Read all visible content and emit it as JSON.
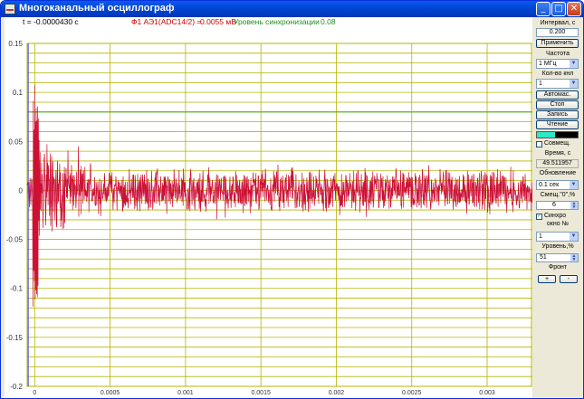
{
  "window": {
    "title": "Многоканальный осциллограф",
    "buttons": {
      "minimize": "_",
      "maximize": "□",
      "close": "✕"
    }
  },
  "plot_header": {
    "time_readout": "t = -0.0000430 с",
    "channel_readout": "Ф1  АЭ1(ADC14/2) =",
    "channel_value": "0.0055 мВ",
    "sync_label": "Уровень синхронизации",
    "sync_value": "0.08"
  },
  "colors": {
    "plot_bg": "#ffffff",
    "grid": "#b5b400",
    "signal": "#cc1133",
    "signal_alt": "#ee66cc",
    "sync_line": "#2fae2f",
    "cursor": "#4a4ad8",
    "time_text": "#000000",
    "channel_text": "#cc0000",
    "sync_text": "#1f8f1f"
  },
  "chart_data": {
    "type": "line",
    "xlim": [
      -5e-05,
      0.0033
    ],
    "ylim": [
      -0.2,
      0.15
    ],
    "x_ticks": [
      "0",
      "0.0005",
      "0.001",
      "0.0015",
      "0.002",
      "0.0025",
      "0.003"
    ],
    "y_ticks": [
      "0.15",
      "0.1",
      "0.05",
      "0",
      "-0.05",
      "-0.1",
      "-0.15",
      "-0.2"
    ],
    "sync_level": 0.08,
    "cursor_x": -4.3e-05,
    "noise_amplitude": 0.02,
    "burst": {
      "x_start": -1.2e-05,
      "x_end": 2.5e-05,
      "max": 0.134,
      "min": -0.17
    },
    "grid": true
  },
  "panel": {
    "interval_label": "Интервал, с",
    "interval_value": "0.200",
    "apply_button": "Применить",
    "frequency_label": "Частота",
    "frequency_value": "1 МГц",
    "channels_label": "Кол-во кнл",
    "channels_value": "1",
    "auto_button": "Автомас.",
    "stop_button": "Стоп",
    "record_button": "Запись",
    "read_button": "Чтение",
    "color_left": "#2ee8c6",
    "color_right": "#000000",
    "combine_label": "Совмещ.",
    "combine_checked": false,
    "time_label": "Время, с",
    "time_value": "49.511957",
    "update_label": "Обновление",
    "update_value": "0.1 сек",
    "offset_label": "Смещ.\"0\",%",
    "offset_value": "6",
    "sync_check_label": "Синхро",
    "sync_checked": true,
    "window_label": "окно №",
    "window_value": "1",
    "level_label": "Уровень,%",
    "level_value": "51",
    "front_label": "Фронт",
    "plus_button": "+",
    "minus_button": "-"
  }
}
